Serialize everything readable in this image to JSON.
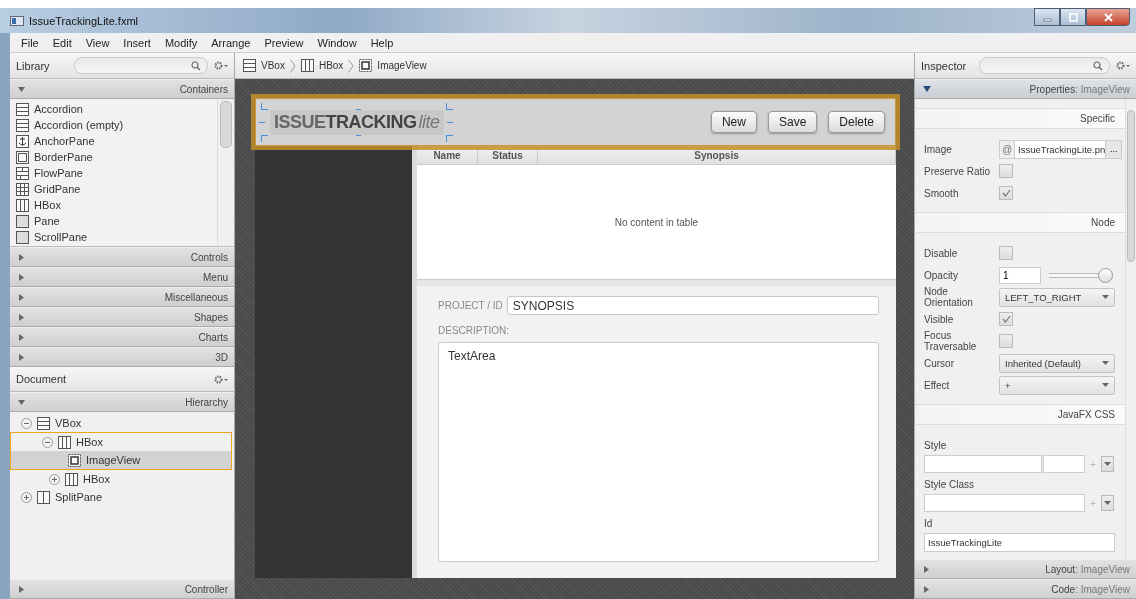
{
  "window": {
    "title": "IssueTrackingLite.fxml"
  },
  "menu": [
    "File",
    "Edit",
    "View",
    "Insert",
    "Modify",
    "Arrange",
    "Preview",
    "Window",
    "Help"
  ],
  "library": {
    "title": "Library",
    "sections": [
      {
        "label": "Containers",
        "expanded": true,
        "items": [
          {
            "label": "Accordion",
            "kind": "accordion"
          },
          {
            "label": "Accordion  (empty)",
            "kind": "accordion"
          },
          {
            "label": "AnchorPane",
            "kind": "anchor"
          },
          {
            "label": "BorderPane",
            "kind": "border"
          },
          {
            "label": "FlowPane",
            "kind": "flow"
          },
          {
            "label": "GridPane",
            "kind": "grid"
          },
          {
            "label": "HBox",
            "kind": "hbox"
          },
          {
            "label": "Pane",
            "kind": "pane"
          },
          {
            "label": "ScrollPane",
            "kind": "pane"
          }
        ]
      },
      {
        "label": "Controls",
        "expanded": false
      },
      {
        "label": "Menu",
        "expanded": false
      },
      {
        "label": "Miscellaneous",
        "expanded": false
      },
      {
        "label": "Shapes",
        "expanded": false
      },
      {
        "label": "Charts",
        "expanded": false
      },
      {
        "label": "3D",
        "expanded": false
      }
    ]
  },
  "document": {
    "title": "Document",
    "section": {
      "label": "Hierarchy",
      "expanded": true
    },
    "tree": [
      {
        "label": "VBox",
        "kind": "vbox",
        "expanded": true,
        "selected": false,
        "children": [
          {
            "label": "HBox",
            "kind": "hbox",
            "expanded": true,
            "selected": false,
            "outlined": true,
            "children": [
              {
                "label": "ImageView",
                "kind": "imageview",
                "selected": true
              }
            ]
          },
          {
            "label": "HBox",
            "kind": "hbox",
            "expanded": false,
            "selected": false,
            "outlined": false
          }
        ]
      },
      {
        "label": "SplitPane",
        "kind": "splitpane",
        "expanded": false,
        "selected": false
      }
    ],
    "controller": {
      "label": "Controller",
      "expanded": false
    }
  },
  "breadcrumb": [
    {
      "label": "VBox",
      "kind": "vbox"
    },
    {
      "label": "HBox",
      "kind": "hbox"
    },
    {
      "label": "ImageView",
      "kind": "imageview"
    }
  ],
  "design": {
    "logo": {
      "first": "ISSUE",
      "second": "TRACKING",
      "suffix": "lite"
    },
    "buttons": [
      "New",
      "Save",
      "Delete"
    ],
    "table": {
      "columns": [
        "Name",
        "Status",
        "Synopsis"
      ],
      "placeholder": "No content in table"
    },
    "form": {
      "project_label": "PROJECT / ID",
      "project_value": "SYNOPSIS",
      "description_label": "DESCRIPTION:",
      "description_value": "TextArea"
    }
  },
  "inspector": {
    "title": "Inspector",
    "properties": {
      "label": "Properties",
      "target": ": ImageView",
      "expanded": true
    },
    "sections": [
      {
        "title": "Specific",
        "rows": [
          {
            "kind": "image",
            "label": "Image",
            "prefix": "@",
            "value": "IssueTrackingLite.pn",
            "button": "..."
          },
          {
            "kind": "checkbox",
            "label": "Preserve Ratio",
            "checked": false
          },
          {
            "kind": "checkbox",
            "label": "Smooth",
            "checked": true
          }
        ]
      },
      {
        "title": "Node",
        "rows": [
          {
            "kind": "checkbox",
            "label": "Disable",
            "checked": false
          },
          {
            "kind": "slider",
            "label": "Opacity",
            "value": "1",
            "level": 1
          },
          {
            "kind": "select",
            "label": "Node Orientation",
            "value": "LEFT_TO_RIGHT"
          },
          {
            "kind": "checkbox",
            "label": "Visible",
            "checked": true
          },
          {
            "kind": "checkbox",
            "label": "Focus Traversable",
            "checked": false
          },
          {
            "kind": "select",
            "label": "Cursor",
            "value": "Inherited (Default)"
          },
          {
            "kind": "select",
            "label": "Effect",
            "value": "+"
          }
        ]
      },
      {
        "title": "JavaFX CSS",
        "rows": [
          {
            "kind": "style",
            "label": "Style",
            "add": "+"
          },
          {
            "kind": "styleclass",
            "label": "Style Class",
            "add": "+"
          },
          {
            "kind": "text",
            "label": "Id",
            "value": "IssueTrackingLite"
          }
        ]
      }
    ],
    "footer": [
      {
        "label": "Layout",
        "target": ": ImageView",
        "expanded": false
      },
      {
        "label": "Code",
        "target": ": ImageView",
        "expanded": false
      }
    ]
  }
}
